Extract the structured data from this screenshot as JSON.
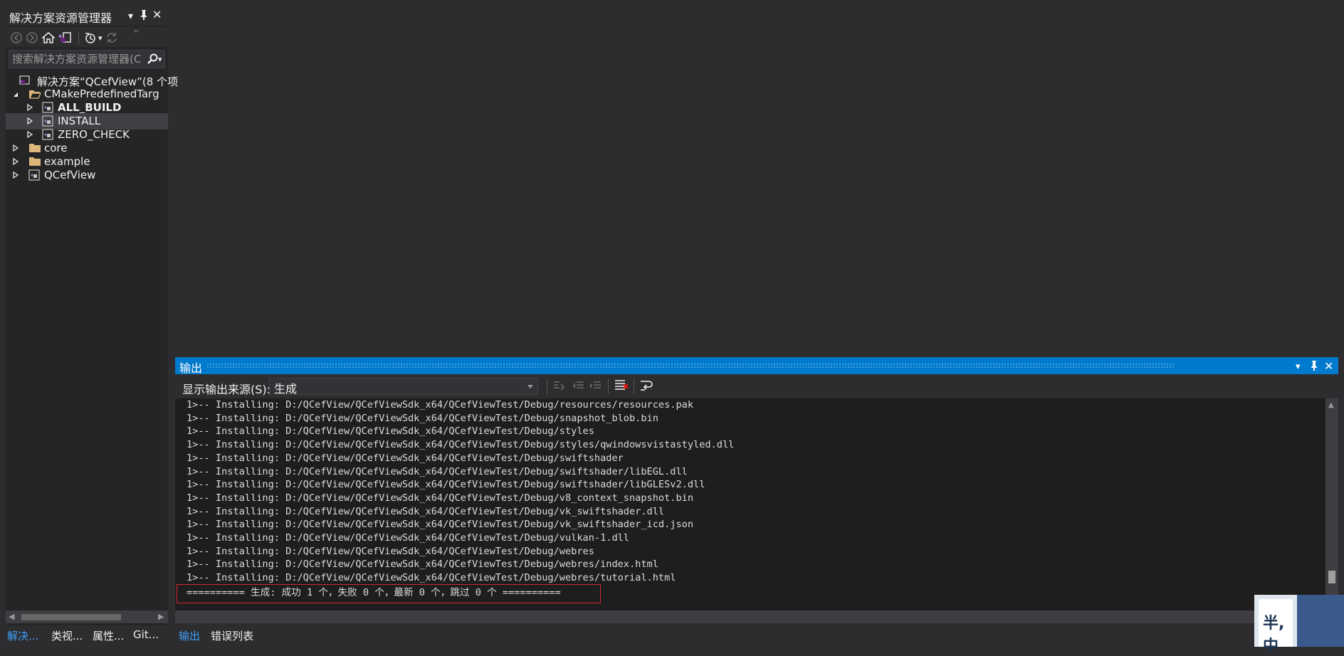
{
  "solution_explorer": {
    "title": "解决方案资源管理器",
    "search_placeholder": "搜索解决方案资源管理器(C",
    "tree": [
      {
        "label": "解决方案“QCefView”(8 个项",
        "icon": "solution-icon",
        "bold": false,
        "selected": false,
        "expanded": null
      },
      {
        "label": "CMakePredefinedTarg",
        "icon": "folder-open-icon",
        "bold": false,
        "selected": false,
        "expanded": true
      },
      {
        "label": "ALL_BUILD",
        "icon": "project-icon",
        "bold": true,
        "selected": false,
        "expanded": false
      },
      {
        "label": "INSTALL",
        "icon": "project-icon",
        "bold": false,
        "selected": true,
        "expanded": false
      },
      {
        "label": "ZERO_CHECK",
        "icon": "project-icon",
        "bold": false,
        "selected": false,
        "expanded": false
      },
      {
        "label": "core",
        "icon": "folder-icon",
        "bold": false,
        "selected": false,
        "expanded": false
      },
      {
        "label": "example",
        "icon": "folder-icon",
        "bold": false,
        "selected": false,
        "expanded": false
      },
      {
        "label": "QCefView",
        "icon": "project-icon",
        "bold": false,
        "selected": false,
        "expanded": false
      }
    ]
  },
  "left_bottom_tabs": [
    "解决...",
    "类视...",
    "属性...",
    "Git..."
  ],
  "output": {
    "title": "输出",
    "source_label": "显示输出来源(S):",
    "source_value": "生成",
    "lines": [
      "1>-- Installing: D:/QCefView/QCefViewSdk_x64/QCefViewTest/Debug/resources/resources.pak",
      "1>-- Installing: D:/QCefView/QCefViewSdk_x64/QCefViewTest/Debug/snapshot_blob.bin",
      "1>-- Installing: D:/QCefView/QCefViewSdk_x64/QCefViewTest/Debug/styles",
      "1>-- Installing: D:/QCefView/QCefViewSdk_x64/QCefViewTest/Debug/styles/qwindowsvistastyled.dll",
      "1>-- Installing: D:/QCefView/QCefViewSdk_x64/QCefViewTest/Debug/swiftshader",
      "1>-- Installing: D:/QCefView/QCefViewSdk_x64/QCefViewTest/Debug/swiftshader/libEGL.dll",
      "1>-- Installing: D:/QCefView/QCefViewSdk_x64/QCefViewTest/Debug/swiftshader/libGLESv2.dll",
      "1>-- Installing: D:/QCefView/QCefViewSdk_x64/QCefViewTest/Debug/v8_context_snapshot.bin",
      "1>-- Installing: D:/QCefView/QCefViewSdk_x64/QCefViewTest/Debug/vk_swiftshader.dll",
      "1>-- Installing: D:/QCefView/QCefViewSdk_x64/QCefViewTest/Debug/vk_swiftshader_icd.json",
      "1>-- Installing: D:/QCefView/QCefViewSdk_x64/QCefViewTest/Debug/vulkan-1.dll",
      "1>-- Installing: D:/QCefView/QCefViewSdk_x64/QCefViewTest/Debug/webres",
      "1>-- Installing: D:/QCefView/QCefViewSdk_x64/QCefViewTest/Debug/webres/index.html",
      "1>-- Installing: D:/QCefView/QCefViewSdk_x64/QCefViewTest/Debug/webres/tutorial.html"
    ],
    "summary": "========== 生成: 成功 1 个，失败 0 个，最新 0 个，跳过 0 个 =========="
  },
  "output_bottom_tabs": [
    "输出",
    "错误列表"
  ],
  "corner_text": "半,中",
  "colors": {
    "accent": "#007acc",
    "highlight_box": "#d9262c",
    "project_icon": "#68217a"
  }
}
